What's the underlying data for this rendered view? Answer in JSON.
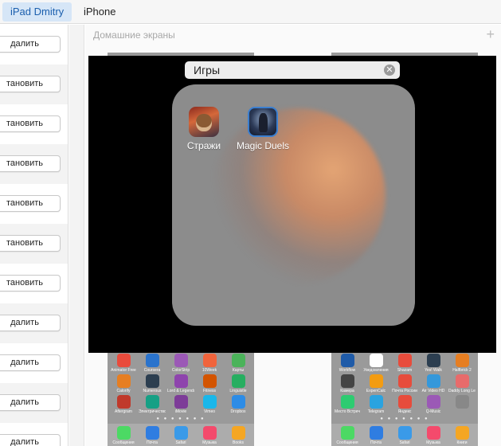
{
  "tabs": [
    {
      "label": "iPad Dmitry",
      "active": true
    },
    {
      "label": "iPhone",
      "active": false
    }
  ],
  "left_list": {
    "rows": [
      {
        "button": "далить"
      },
      {
        "button": "тановить"
      },
      {
        "button": "тановить"
      },
      {
        "button": "тановить"
      },
      {
        "button": "тановить"
      },
      {
        "button": "тановить"
      },
      {
        "button": "тановить"
      },
      {
        "button": "далить"
      },
      {
        "button": "далить"
      },
      {
        "button": "далить"
      },
      {
        "button": "далить"
      }
    ]
  },
  "home_screens": {
    "title": "Домашние экраны",
    "add_icon": "plus-icon",
    "screen1_apps": [
      {
        "label": "Animator Free",
        "color": "#e94b3c"
      },
      {
        "label": "Coursera",
        "color": "#2a73cc"
      },
      {
        "label": "ColorStrip",
        "color": "#9b59b6"
      },
      {
        "label": "10Week",
        "color": "#f0643c"
      },
      {
        "label": "Карты",
        "color": "#4bb35a"
      },
      {
        "label": "Calorify",
        "color": "#e67e22"
      },
      {
        "label": "Numerous",
        "color": "#2c3e50"
      },
      {
        "label": "Lord & Legends",
        "color": "#8e44ad"
      },
      {
        "label": "Fitness",
        "color": "#d35400"
      },
      {
        "label": "Linguistle",
        "color": "#27ae60"
      },
      {
        "label": "Aftergram",
        "color": "#c0392b"
      },
      {
        "label": "Электричество",
        "color": "#16a085"
      },
      {
        "label": "iMovie",
        "color": "#7d3c98"
      },
      {
        "label": "Vimeo",
        "color": "#1ab7ea"
      },
      {
        "label": "Dropbox",
        "color": "#2d8ce6"
      }
    ],
    "screen1_dock": [
      {
        "label": "Сообщения",
        "color": "#4cd964"
      },
      {
        "label": "Почта",
        "color": "#2f7de1"
      },
      {
        "label": "Safari",
        "color": "#3a9ae8"
      },
      {
        "label": "Музыка",
        "color": "#f44a6c"
      },
      {
        "label": "Books",
        "color": "#f5a623"
      }
    ],
    "screen2_apps": [
      {
        "label": "Workflow",
        "color": "#1f5ba8"
      },
      {
        "label": "Уведомления",
        "color": "#ffffff"
      },
      {
        "label": "Shazam",
        "color": "#e74c3c"
      },
      {
        "label": "Yes! Walk",
        "color": "#2c3e50"
      },
      {
        "label": "Halfbrick 2",
        "color": "#e67e22"
      },
      {
        "label": "Камера",
        "color": "#444444"
      },
      {
        "label": "ExpenCalc",
        "color": "#f39c12"
      },
      {
        "label": "Почта России",
        "color": "#e74c3c"
      },
      {
        "label": "Air Video HD",
        "color": "#3498db"
      },
      {
        "label": "Daddy Long Legs",
        "color": "#e86b6b"
      },
      {
        "label": "Место Встреч",
        "color": "#2ecc71"
      },
      {
        "label": "Telegram",
        "color": "#2aa3e0"
      },
      {
        "label": "Яндекс",
        "color": "#e74c3c"
      },
      {
        "label": "Q-Music",
        "color": "#9b59b6"
      },
      {
        "label": "",
        "color": "#888888"
      }
    ],
    "screen2_dock": [
      {
        "label": "Сообщения",
        "color": "#4cd964"
      },
      {
        "label": "Почта",
        "color": "#2f7de1"
      },
      {
        "label": "Safari",
        "color": "#3a9ae8"
      },
      {
        "label": "Музыка",
        "color": "#f44a6c"
      },
      {
        "label": "Книги",
        "color": "#f5a623"
      }
    ]
  },
  "folder": {
    "name": "Игры",
    "clear_icon": "clear-icon",
    "apps": [
      {
        "label": "Стражи",
        "icon": "guardians-app-icon"
      },
      {
        "label": "Magic Duels",
        "icon": "magic-duels-app-icon"
      }
    ]
  }
}
